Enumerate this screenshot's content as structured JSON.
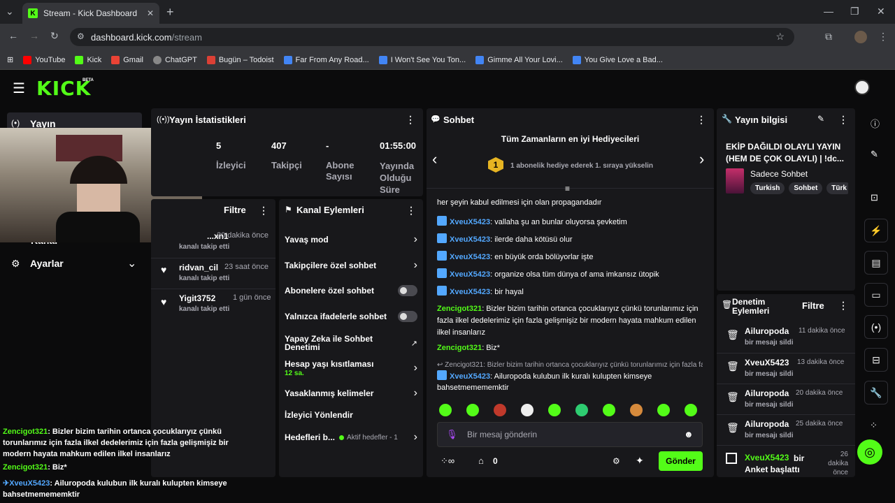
{
  "browser": {
    "tab_title": "Stream - Kick Dashboard",
    "url_host": "dashboard.kick.com",
    "url_path": "/stream",
    "bookmarks": [
      "YouTube",
      "Kick",
      "Gmail",
      "ChatGPT",
      "Bugün – Todoist",
      "Far From Any Road...",
      "I Won't See You Ton...",
      "Gimme All Your Lovi...",
      "You Give Love a Bad..."
    ]
  },
  "header": {
    "logo": "KICK",
    "beta": "BETA"
  },
  "left_nav": {
    "yayin": "Yayın",
    "kanal": "Kanal",
    "ayarlar": "Ayarlar"
  },
  "stats": {
    "title": "Yayın İstatistikleri",
    "items": [
      {
        "value": "5",
        "label": "İzleyici"
      },
      {
        "value": "407",
        "label": "Takipçi"
      },
      {
        "value": "-",
        "label": "Abone Sayısı"
      },
      {
        "value": "01:55:00",
        "label": "Yayında Olduğu Süre"
      }
    ]
  },
  "activity": {
    "filter": "Filtre",
    "items": [
      {
        "name": "...xn1",
        "time": "20 dakika önce",
        "action": "kanalı takip etti"
      },
      {
        "name": "ridvan_cil",
        "time": "23 saat önce",
        "action": "kanalı takip etti"
      },
      {
        "name": "Yigit3752",
        "time": "1 gün önce",
        "action": "kanalı takip etti"
      }
    ]
  },
  "channel_actions": {
    "title": "Kanal Eylemleri",
    "slow_mode": "Yavaş mod",
    "followers_only": "Takipçilere özel sohbet",
    "subs_only": "Abonelere özel sohbet",
    "emotes_only": "Yalnızca ifadelerle sohbet",
    "ai_moderation": "Yapay Zeka ile Sohbet Denetimi",
    "account_age": "Hesap yaşı kısıtlaması",
    "account_age_value": "12 sa.",
    "banned_words": "Yasaklanmış kelimeler",
    "raid": "İzleyici Yönlendir",
    "goals": "Hedefleri b...",
    "goals_status": "Aktif hedefler - 1"
  },
  "chat": {
    "title": "Sohbet",
    "gifters_title": "Tüm Zamanların en iyi Hediyecileri",
    "gifters_rank": "1",
    "gifters_text": "1 abonelik hediye ederek 1. sıraya yükselin",
    "partial_line": "her şeyin kabul edilmesi için olan propagandadır",
    "messages": [
      {
        "user": "XveuX5423",
        "text": ": vallaha şu an bunlar oluyorsa şevketim"
      },
      {
        "user": "XveuX5423",
        "text": ": ilerde daha kötüsü olur"
      },
      {
        "user": "XveuX5423",
        "text": ": en büyük orda bölüyorlar işte"
      },
      {
        "user": "XveuX5423",
        "text": ": organize olsa tüm dünya of ama imkansız ütopik"
      },
      {
        "user": "XveuX5423",
        "text": ": bir hayal"
      }
    ],
    "zen_msg1_user": "Zencigot321",
    "zen_msg1_text": ": Bizler bizim tarihin ortanca çocuklarıyız çünkü torunlarımız için fazla ilkel dedelerimiz için fazla gelişmişiz bir modern hayata mahkum edilen ilkel insanlarız",
    "zen_msg2_user": "Zencigot321",
    "zen_msg2_text": ": Biz*",
    "reply_ref": "Zencigot321: Bizler bizim tarihin ortanca çocuklarıyız çünkü torunlarımız için fazla faz...",
    "reply_user": "XveuX5423",
    "reply_text": ": Ailuropoda kulubun ilk kuralı kulupten kimseye bahsetmemememktir",
    "input_placeholder": "Bir mesaj gönderin",
    "kicks_count": "0",
    "send_label": "Gönder"
  },
  "stream_info": {
    "title": "Yayın bilgisi",
    "stream_title": "EKİP DAĞILDI OLAYLI YAYIN (HEM DE ÇOK OLAYLI) | !dc...",
    "category": "Sadece Sohbet",
    "tags": [
      "Turkish",
      "Sohbet",
      "Türk"
    ]
  },
  "mod_log": {
    "title": "Denetim Eylemleri",
    "filter": "Filtre",
    "items": [
      {
        "name": "Ailuropoda",
        "time": "11 dakika önce",
        "action": "bir mesajı sildi"
      },
      {
        "name": "XveuX5423",
        "time": "13 dakika önce",
        "action": "bir mesajı sildi"
      },
      {
        "name": "Ailuropoda",
        "time": "20 dakika önce",
        "action": "bir mesajı sildi"
      },
      {
        "name": "Ailuropoda",
        "time": "25 dakika önce",
        "action": "bir mesajı sildi"
      }
    ],
    "poll_user": "XveuX5423",
    "poll_text": "bir Anket başlattı",
    "poll_time": "26 dakika önce"
  },
  "overlay_chat": {
    "l1_user": "Zencigot321",
    "l1_text": ": Bizler bizim tarihin ortanca çocuklarıyız çünkü torunlarımız için fazla ilkel dedelerimiz için fazla gelişmişiz bir modern hayata mahkum edilen ilkel insanlarız",
    "l2_user": "Zencigot321",
    "l2_text": ": Biz*",
    "l3_user": "XveuX5423",
    "l3_text": ": Ailuropoda kulubun ilk kuralı kulupten kimseye bahsetmemememktir"
  },
  "colors": {
    "accent": "#53fc18",
    "panel": "#18181b",
    "bg": "#0b0b0c"
  }
}
